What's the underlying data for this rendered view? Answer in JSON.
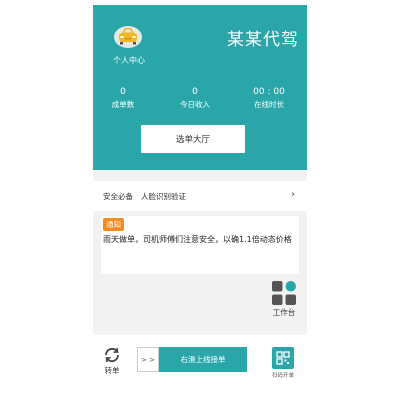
{
  "header": {
    "brand": "某某代驾",
    "profile_label": "个人中心"
  },
  "stats": [
    {
      "value": "0",
      "label": "成单数"
    },
    {
      "value": "0",
      "label": "今日收入"
    },
    {
      "value": "00 : 00",
      "label": "在线时长"
    }
  ],
  "hall_button": "选单大厅",
  "verify": {
    "tag": "安全必备",
    "text": "人脸识别验证"
  },
  "notice": {
    "badge": "通知",
    "text": "雨天做单，司机师傅们注意安全，以确1.1倍动态价格"
  },
  "workbench_label": "工作台",
  "bottom": {
    "transfer_label": "转单",
    "slider_handle": "> >",
    "slider_label": "右滑上线接单",
    "scan_label": "扫码开单"
  },
  "colors": {
    "primary": "#2aa6a8",
    "notice_badge": "#f58b1f"
  }
}
